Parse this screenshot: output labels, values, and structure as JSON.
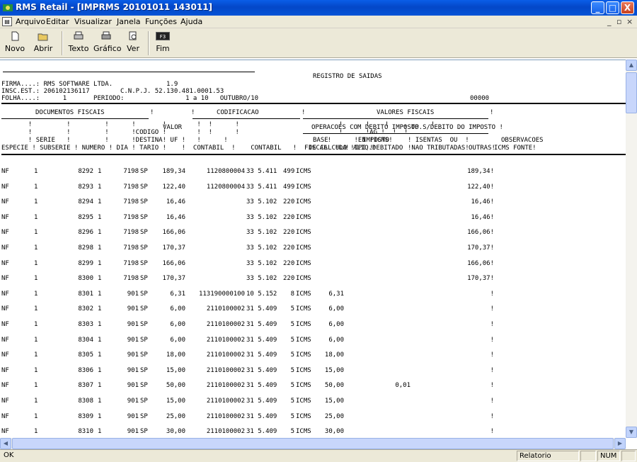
{
  "window": {
    "title": "RMS Retail - [IMPRMS 20101011 143011]",
    "controls": [
      "_",
      "□",
      "X"
    ]
  },
  "menu": {
    "items": [
      "Arquivo",
      "Editar",
      "Visualizar",
      "Janela",
      "Funções",
      "Ajuda"
    ]
  },
  "toolbar": {
    "buttons": [
      {
        "label": "Novo",
        "icon": "new-document-icon"
      },
      {
        "label": "Abrir",
        "icon": "open-folder-icon"
      },
      {
        "label": "Texto",
        "icon": "print-text-icon"
      },
      {
        "label": "Gráfico",
        "icon": "print-graphic-icon"
      },
      {
        "label": "Ver",
        "icon": "preview-icon"
      },
      {
        "label": "Fim",
        "icon": "f3-key-icon"
      }
    ],
    "f3_key": "F3"
  },
  "report": {
    "title": "REGISTRO DE SAIDAS",
    "firma_line": "FIRMA....: RMS SOFTWARE LTDA.              1.9",
    "insc_line": "INSC.EST.: 206102136117        C.N.P.J. 52.130.481.0001.53",
    "folha_line": "FOLHA....:      1       PERIODO:                1 a 10   OUTUBRO/10",
    "page_no": "00000",
    "header": {
      "documentos_fiscais": "DOCUMENTOS FISCAIS",
      "codificacao": "CODIFICACAO",
      "valores_fiscais": "VALORES FISCAIS",
      "valor": "VALOR",
      "op_debito": "OPERACOES COM DEBITO IMPOSTO",
      "op_sem_debito": "! OP.S/DEBITO DO IMPOSTO !",
      "line_a": "       !         !         !      !       !        !  !      !                          !      !    !           !",
      "line_b": "       !         !         !      !CODIGO !        !  !      !                          !      !AG !  !  !",
      "line_c": "       ! SERIE   !         !      !DESTINA! UF !   !      !                          !      !EN !ICMS!",
      "line_d": "ESPECIE ! SUBSERIE ! NUMERO ! DIA ! TARIO !    !  CONTABIL  !    CONTABIL   !  FISCAL  !DA !IPI !",
      "col_base": "BASE",
      "col_base2": "DE CALCULO",
      "col_aliq": "! ALIQ.!",
      "col_imposto": "IMPOSTO",
      "col_imposto2": "DEBITADO",
      "col_isentas": "! ISENTAS  OU  !",
      "col_isentas2": "!NAO TRIBUTADAS!",
      "col_outras": "OUTRAS!",
      "col_obs": "OBSERVACOES",
      "col_obs2": "ICMS FONTE!"
    },
    "rows": [
      {
        "especie": "NF",
        "serie": "1",
        "numero": "8292",
        "dia": "1",
        "destinatario": "7198",
        "uf": "SP",
        "valor": "189,34",
        "contabil": "1120800004",
        "fiscal": "33 5.411",
        "ag": "499",
        "imp": "ICMS",
        "base": "",
        "imposto": "",
        "outras": "189,34!"
      },
      {
        "especie": "NF",
        "serie": "1",
        "numero": "8293",
        "dia": "1",
        "destinatario": "7198",
        "uf": "SP",
        "valor": "122,40",
        "contabil": "1120800004",
        "fiscal": "33 5.411",
        "ag": "499",
        "imp": "ICMS",
        "base": "",
        "imposto": "",
        "outras": "122,40!"
      },
      {
        "especie": "NF",
        "serie": "1",
        "numero": "8294",
        "dia": "1",
        "destinatario": "7198",
        "uf": "SP",
        "valor": "16,46",
        "contabil": "",
        "fiscal": "33 5.102",
        "ag": "220",
        "imp": "ICMS",
        "base": "",
        "imposto": "",
        "outras": "16,46!"
      },
      {
        "especie": "NF",
        "serie": "1",
        "numero": "8295",
        "dia": "1",
        "destinatario": "7198",
        "uf": "SP",
        "valor": "16,46",
        "contabil": "",
        "fiscal": "33 5.102",
        "ag": "220",
        "imp": "ICMS",
        "base": "",
        "imposto": "",
        "outras": "16,46!"
      },
      {
        "especie": "NF",
        "serie": "1",
        "numero": "8296",
        "dia": "1",
        "destinatario": "7198",
        "uf": "SP",
        "valor": "166,06",
        "contabil": "",
        "fiscal": "33 5.102",
        "ag": "220",
        "imp": "ICMS",
        "base": "",
        "imposto": "",
        "outras": "166,06!"
      },
      {
        "especie": "NF",
        "serie": "1",
        "numero": "8298",
        "dia": "1",
        "destinatario": "7198",
        "uf": "SP",
        "valor": "170,37",
        "contabil": "",
        "fiscal": "33 5.102",
        "ag": "220",
        "imp": "ICMS",
        "base": "",
        "imposto": "",
        "outras": "170,37!"
      },
      {
        "especie": "NF",
        "serie": "1",
        "numero": "8299",
        "dia": "1",
        "destinatario": "7198",
        "uf": "SP",
        "valor": "166,06",
        "contabil": "",
        "fiscal": "33 5.102",
        "ag": "220",
        "imp": "ICMS",
        "base": "",
        "imposto": "",
        "outras": "166,06!"
      },
      {
        "especie": "NF",
        "serie": "1",
        "numero": "8300",
        "dia": "1",
        "destinatario": "7198",
        "uf": "SP",
        "valor": "170,37",
        "contabil": "",
        "fiscal": "33 5.102",
        "ag": "220",
        "imp": "ICMS",
        "base": "",
        "imposto": "",
        "outras": "170,37!"
      },
      {
        "especie": "NF",
        "serie": "1",
        "numero": "8301",
        "dia": "1",
        "destinatario": "901",
        "uf": "SP",
        "valor": "6,31",
        "contabil": "113190000100",
        "fiscal": "10 5.152",
        "ag": "8",
        "imp": "ICMS",
        "base": "6,31",
        "imposto": "",
        "outras": "!"
      },
      {
        "especie": "NF",
        "serie": "1",
        "numero": "8302",
        "dia": "1",
        "destinatario": "901",
        "uf": "SP",
        "valor": "6,00",
        "contabil": "2110100002",
        "fiscal": "31 5.409",
        "ag": "5",
        "imp": "ICMS",
        "base": "6,00",
        "imposto": "",
        "outras": "!"
      },
      {
        "especie": "NF",
        "serie": "1",
        "numero": "8303",
        "dia": "1",
        "destinatario": "901",
        "uf": "SP",
        "valor": "6,00",
        "contabil": "2110100002",
        "fiscal": "31 5.409",
        "ag": "5",
        "imp": "ICMS",
        "base": "6,00",
        "imposto": "",
        "outras": "!"
      },
      {
        "especie": "NF",
        "serie": "1",
        "numero": "8304",
        "dia": "1",
        "destinatario": "901",
        "uf": "SP",
        "valor": "6,00",
        "contabil": "2110100002",
        "fiscal": "31 5.409",
        "ag": "5",
        "imp": "ICMS",
        "base": "6,00",
        "imposto": "",
        "outras": "!"
      },
      {
        "especie": "NF",
        "serie": "1",
        "numero": "8305",
        "dia": "1",
        "destinatario": "901",
        "uf": "SP",
        "valor": "18,00",
        "contabil": "2110100002",
        "fiscal": "31 5.409",
        "ag": "5",
        "imp": "ICMS",
        "base": "18,00",
        "imposto": "",
        "outras": "!"
      },
      {
        "especie": "NF",
        "serie": "1",
        "numero": "8306",
        "dia": "1",
        "destinatario": "901",
        "uf": "SP",
        "valor": "15,00",
        "contabil": "2110100002",
        "fiscal": "31 5.409",
        "ag": "5",
        "imp": "ICMS",
        "base": "15,00",
        "imposto": "",
        "outras": "!"
      },
      {
        "especie": "NF",
        "serie": "1",
        "numero": "8307",
        "dia": "1",
        "destinatario": "901",
        "uf": "SP",
        "valor": "50,00",
        "contabil": "2110100002",
        "fiscal": "31 5.409",
        "ag": "5",
        "imp": "ICMS",
        "base": "50,00",
        "imposto": "0,01",
        "outras": "!"
      },
      {
        "especie": "NF",
        "serie": "1",
        "numero": "8308",
        "dia": "1",
        "destinatario": "901",
        "uf": "SP",
        "valor": "15,00",
        "contabil": "2110100002",
        "fiscal": "31 5.409",
        "ag": "5",
        "imp": "ICMS",
        "base": "15,00",
        "imposto": "",
        "outras": "!"
      },
      {
        "especie": "NF",
        "serie": "1",
        "numero": "8309",
        "dia": "1",
        "destinatario": "901",
        "uf": "SP",
        "valor": "25,00",
        "contabil": "2110100002",
        "fiscal": "31 5.409",
        "ag": "5",
        "imp": "ICMS",
        "base": "25,00",
        "imposto": "",
        "outras": "!"
      },
      {
        "especie": "NF",
        "serie": "1",
        "numero": "8310",
        "dia": "1",
        "destinatario": "901",
        "uf": "SP",
        "valor": "30,00",
        "contabil": "2110100002",
        "fiscal": "31 5.409",
        "ag": "5",
        "imp": "ICMS",
        "base": "30,00",
        "imposto": "",
        "outras": "!"
      }
    ]
  },
  "status": {
    "left": "OK",
    "mode": "Relatorio",
    "num": "NUM"
  }
}
